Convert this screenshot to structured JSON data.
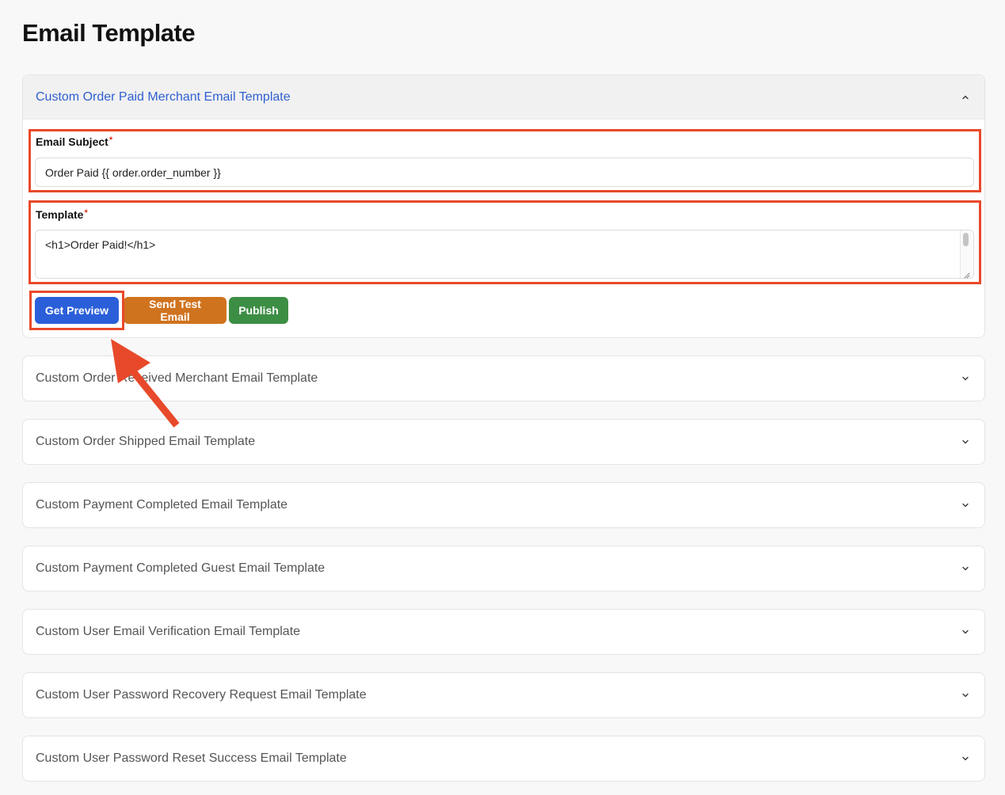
{
  "page": {
    "title": "Email Template"
  },
  "open_section": {
    "title": "Custom Order Paid Merchant Email Template",
    "subject_label": "Email Subject",
    "subject_value": "Order Paid {{ order.order_number }}",
    "template_label": "Template",
    "template_value": "<h1>Order Paid!</h1>",
    "required_marker": "*",
    "buttons": {
      "preview": "Get Preview",
      "test": "Send Test Email",
      "publish": "Publish"
    },
    "colors": {
      "preview": "#2b5fd9",
      "test": "#d0731f",
      "publish": "#3d8e45"
    }
  },
  "collapsed_sections": [
    {
      "title": "Custom Order Received Merchant Email Template"
    },
    {
      "title": "Custom Order Shipped Email Template"
    },
    {
      "title": "Custom Payment Completed Email Template"
    },
    {
      "title": "Custom Payment Completed Guest Email Template"
    },
    {
      "title": "Custom User Email Verification Email Template"
    },
    {
      "title": "Custom User Password Recovery Request Email Template"
    },
    {
      "title": "Custom User Password Reset Success Email Template"
    }
  ],
  "icons": {
    "expanded": "chevron-up-icon",
    "collapsed": "chevron-down-icon"
  },
  "annotation_color": "#e8492a"
}
